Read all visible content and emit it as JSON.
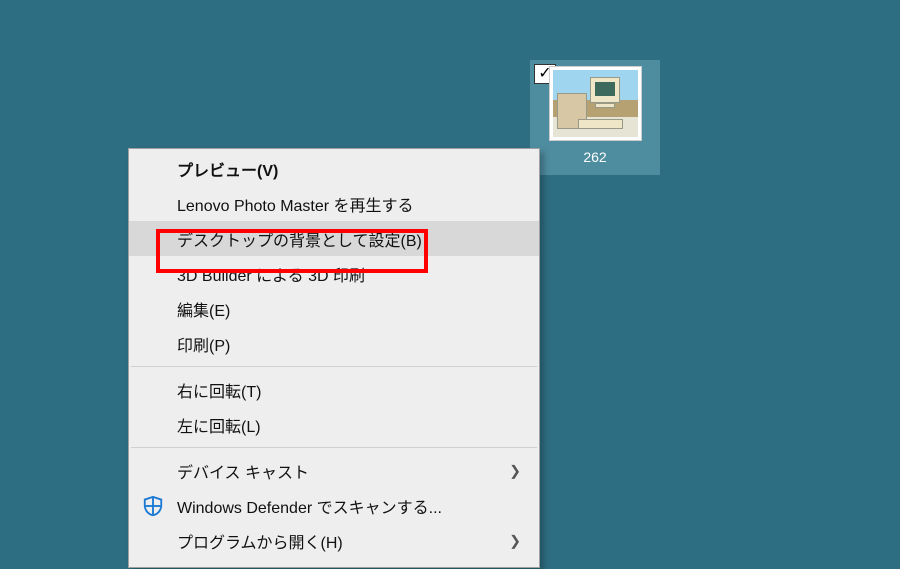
{
  "desktop": {
    "icon": {
      "checked": true,
      "label": "262"
    }
  },
  "context_menu": {
    "items": [
      {
        "label": "プレビュー(V)",
        "bold": true
      },
      {
        "label": "Lenovo Photo Master を再生する"
      },
      {
        "label": "デスクトップの背景として設定(B)",
        "highlighted": true,
        "hover": true
      },
      {
        "label": "3D Builder による 3D 印刷"
      },
      {
        "label": "編集(E)"
      },
      {
        "label": "印刷(P)"
      },
      {
        "separator": true
      },
      {
        "label": "右に回転(T)"
      },
      {
        "label": "左に回転(L)"
      },
      {
        "separator": true
      },
      {
        "label": "デバイス キャスト",
        "submenu": true
      },
      {
        "label": "Windows Defender でスキャンする...",
        "icon": "defender"
      },
      {
        "label": "プログラムから開く(H)",
        "submenu": true
      }
    ]
  }
}
